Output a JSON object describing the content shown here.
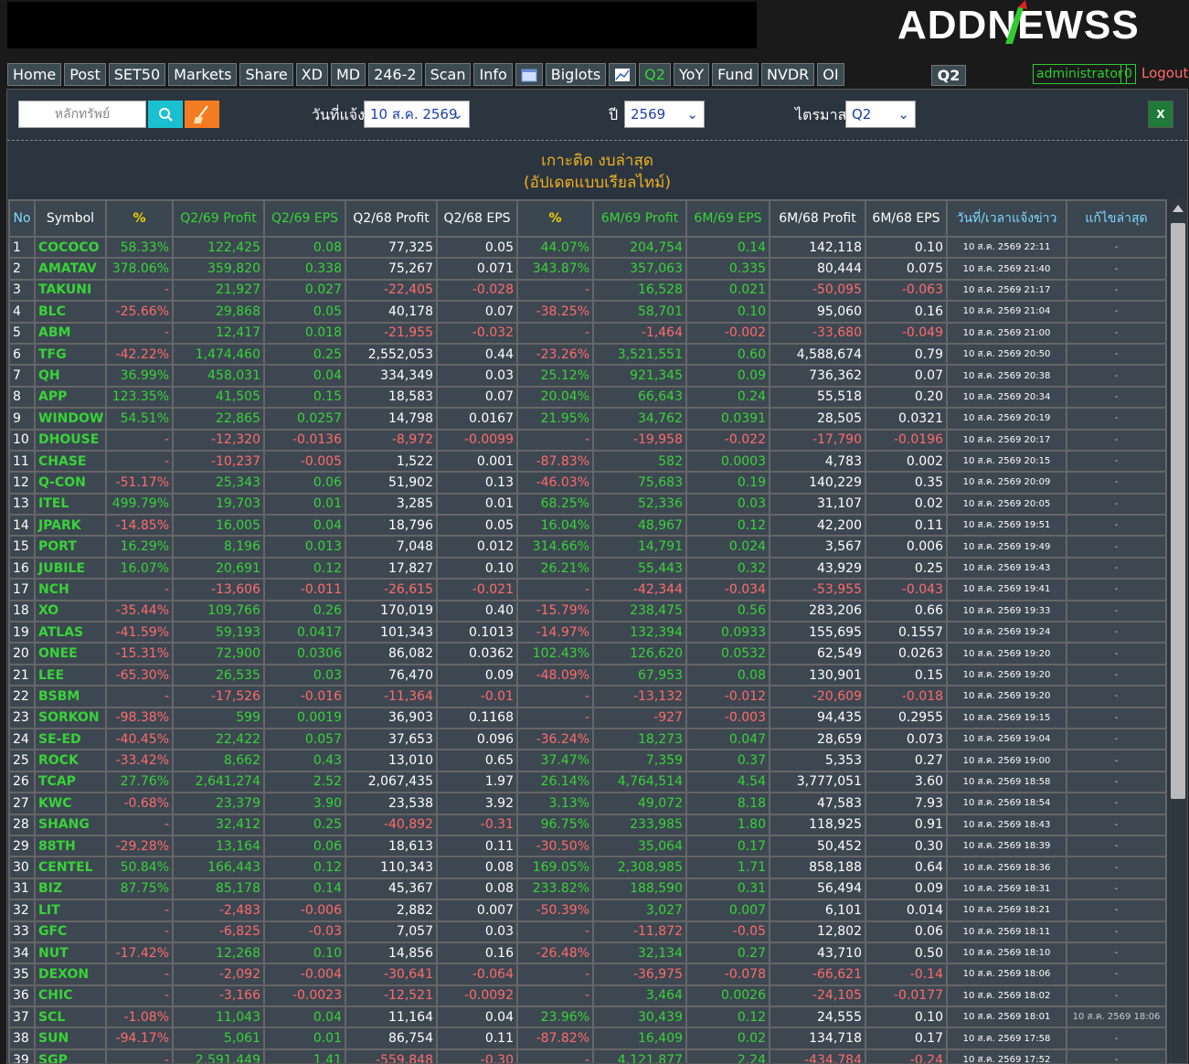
{
  "logo": "ADDNEWSS",
  "nav": [
    {
      "label": "Home",
      "type": "text"
    },
    {
      "label": "Post",
      "type": "text"
    },
    {
      "label": "SET50",
      "type": "text"
    },
    {
      "label": "Markets",
      "type": "text"
    },
    {
      "label": "Share",
      "type": "text"
    },
    {
      "label": "XD",
      "type": "text"
    },
    {
      "label": "MD",
      "type": "text"
    },
    {
      "label": "246-2",
      "type": "text"
    },
    {
      "label": "Scan",
      "type": "text"
    },
    {
      "label": "Info",
      "type": "text"
    },
    {
      "label": "",
      "type": "calendar-icon"
    },
    {
      "label": "Biglots",
      "type": "text"
    },
    {
      "label": "",
      "type": "chart-icon"
    },
    {
      "label": "Q2",
      "type": "green"
    },
    {
      "label": "YoY",
      "type": "text"
    },
    {
      "label": "Fund",
      "type": "text"
    },
    {
      "label": "NVDR",
      "type": "text"
    },
    {
      "label": "OI",
      "type": "text"
    }
  ],
  "quarter_badge": "Q2",
  "user": {
    "name": "administrator",
    "count": "0",
    "logout": "Logout"
  },
  "filters": {
    "search_placeholder": "หลักทรัพย์",
    "date_label": "วันที่แจ้ง",
    "date_value": "10 ส.ค. 2569",
    "year_label": "ปี",
    "year_value": "2569",
    "quarter_label": "ไตรมาส",
    "quarter_value": "Q2",
    "excel": "X"
  },
  "title_line1": "เกาะติด งบล่าสุด",
  "title_line2": "(อัปเดตแบบเรียลไทม์)",
  "headers": [
    "No",
    "Symbol",
    "%",
    "Q2/69 Profit",
    "Q2/69 EPS",
    "Q2/68 Profit",
    "Q2/68 EPS",
    "%",
    "6M/69 Profit",
    "6M/69 EPS",
    "6M/68 Profit",
    "6M/68 EPS",
    "วันที่/เวลาแจ้งข่าว",
    "แก้ไขล่าสุด"
  ],
  "rows": [
    [
      "1",
      "COCOCO",
      "58.33%",
      "122,425",
      "0.08",
      "77,325",
      "0.05",
      "44.07%",
      "204,754",
      "0.14",
      "142,118",
      "0.10",
      "10 ส.ค. 2569 22:11",
      "-"
    ],
    [
      "2",
      "AMATAV",
      "378.06%",
      "359,820",
      "0.338",
      "75,267",
      "0.071",
      "343.87%",
      "357,063",
      "0.335",
      "80,444",
      "0.075",
      "10 ส.ค. 2569 21:40",
      "-"
    ],
    [
      "3",
      "TAKUNI",
      "-",
      "21,927",
      "0.027",
      "-22,405",
      "-0.028",
      "-",
      "16,528",
      "0.021",
      "-50,095",
      "-0.063",
      "10 ส.ค. 2569 21:17",
      "-"
    ],
    [
      "4",
      "BLC",
      "-25.66%",
      "29,868",
      "0.05",
      "40,178",
      "0.07",
      "-38.25%",
      "58,701",
      "0.10",
      "95,060",
      "0.16",
      "10 ส.ค. 2569 21:04",
      "-"
    ],
    [
      "5",
      "ABM",
      "-",
      "12,417",
      "0.018",
      "-21,955",
      "-0.032",
      "-",
      "-1,464",
      "-0.002",
      "-33,680",
      "-0.049",
      "10 ส.ค. 2569 21:00",
      "-"
    ],
    [
      "6",
      "TFG",
      "-42.22%",
      "1,474,460",
      "0.25",
      "2,552,053",
      "0.44",
      "-23.26%",
      "3,521,551",
      "0.60",
      "4,588,674",
      "0.79",
      "10 ส.ค. 2569 20:50",
      "-"
    ],
    [
      "7",
      "QH",
      "36.99%",
      "458,031",
      "0.04",
      "334,349",
      "0.03",
      "25.12%",
      "921,345",
      "0.09",
      "736,362",
      "0.07",
      "10 ส.ค. 2569 20:38",
      "-"
    ],
    [
      "8",
      "APP",
      "123.35%",
      "41,505",
      "0.15",
      "18,583",
      "0.07",
      "20.04%",
      "66,643",
      "0.24",
      "55,518",
      "0.20",
      "10 ส.ค. 2569 20:34",
      "-"
    ],
    [
      "9",
      "WINDOW",
      "54.51%",
      "22,865",
      "0.0257",
      "14,798",
      "0.0167",
      "21.95%",
      "34,762",
      "0.0391",
      "28,505",
      "0.0321",
      "10 ส.ค. 2569 20:19",
      "-"
    ],
    [
      "10",
      "DHOUSE",
      "-",
      "-12,320",
      "-0.0136",
      "-8,972",
      "-0.0099",
      "-",
      "-19,958",
      "-0.022",
      "-17,790",
      "-0.0196",
      "10 ส.ค. 2569 20:17",
      "-"
    ],
    [
      "11",
      "CHASE",
      "-",
      "-10,237",
      "-0.005",
      "1,522",
      "0.001",
      "-87.83%",
      "582",
      "0.0003",
      "4,783",
      "0.002",
      "10 ส.ค. 2569 20:15",
      "-"
    ],
    [
      "12",
      "Q-CON",
      "-51.17%",
      "25,343",
      "0.06",
      "51,902",
      "0.13",
      "-46.03%",
      "75,683",
      "0.19",
      "140,229",
      "0.35",
      "10 ส.ค. 2569 20:09",
      "-"
    ],
    [
      "13",
      "ITEL",
      "499.79%",
      "19,703",
      "0.01",
      "3,285",
      "0.01",
      "68.25%",
      "52,336",
      "0.03",
      "31,107",
      "0.02",
      "10 ส.ค. 2569 20:05",
      "-"
    ],
    [
      "14",
      "JPARK",
      "-14.85%",
      "16,005",
      "0.04",
      "18,796",
      "0.05",
      "16.04%",
      "48,967",
      "0.12",
      "42,200",
      "0.11",
      "10 ส.ค. 2569 19:51",
      "-"
    ],
    [
      "15",
      "PORT",
      "16.29%",
      "8,196",
      "0.013",
      "7,048",
      "0.012",
      "314.66%",
      "14,791",
      "0.024",
      "3,567",
      "0.006",
      "10 ส.ค. 2569 19:49",
      "-"
    ],
    [
      "16",
      "JUBILE",
      "16.07%",
      "20,691",
      "0.12",
      "17,827",
      "0.10",
      "26.21%",
      "55,443",
      "0.32",
      "43,929",
      "0.25",
      "10 ส.ค. 2569 19:43",
      "-"
    ],
    [
      "17",
      "NCH",
      "-",
      "-13,606",
      "-0.011",
      "-26,615",
      "-0.021",
      "-",
      "-42,344",
      "-0.034",
      "-53,955",
      "-0.043",
      "10 ส.ค. 2569 19:41",
      "-"
    ],
    [
      "18",
      "XO",
      "-35.44%",
      "109,766",
      "0.26",
      "170,019",
      "0.40",
      "-15.79%",
      "238,475",
      "0.56",
      "283,206",
      "0.66",
      "10 ส.ค. 2569 19:33",
      "-"
    ],
    [
      "19",
      "ATLAS",
      "-41.59%",
      "59,193",
      "0.0417",
      "101,343",
      "0.1013",
      "-14.97%",
      "132,394",
      "0.0933",
      "155,695",
      "0.1557",
      "10 ส.ค. 2569 19:24",
      "-"
    ],
    [
      "20",
      "ONEE",
      "-15.31%",
      "72,900",
      "0.0306",
      "86,082",
      "0.0362",
      "102.43%",
      "126,620",
      "0.0532",
      "62,549",
      "0.0263",
      "10 ส.ค. 2569 19:20",
      "-"
    ],
    [
      "21",
      "LEE",
      "-65.30%",
      "26,535",
      "0.03",
      "76,470",
      "0.09",
      "-48.09%",
      "67,953",
      "0.08",
      "130,901",
      "0.15",
      "10 ส.ค. 2569 19:20",
      "-"
    ],
    [
      "22",
      "BSBM",
      "-",
      "-17,526",
      "-0.016",
      "-11,364",
      "-0.01",
      "-",
      "-13,132",
      "-0.012",
      "-20,609",
      "-0.018",
      "10 ส.ค. 2569 19:20",
      "-"
    ],
    [
      "23",
      "SORKON",
      "-98.38%",
      "599",
      "0.0019",
      "36,903",
      "0.1168",
      "-",
      "-927",
      "-0.003",
      "94,435",
      "0.2955",
      "10 ส.ค. 2569 19:15",
      "-"
    ],
    [
      "24",
      "SE-ED",
      "-40.45%",
      "22,422",
      "0.057",
      "37,653",
      "0.096",
      "-36.24%",
      "18,273",
      "0.047",
      "28,659",
      "0.073",
      "10 ส.ค. 2569 19:04",
      "-"
    ],
    [
      "25",
      "ROCK",
      "-33.42%",
      "8,662",
      "0.43",
      "13,010",
      "0.65",
      "37.47%",
      "7,359",
      "0.37",
      "5,353",
      "0.27",
      "10 ส.ค. 2569 19:00",
      "-"
    ],
    [
      "26",
      "TCAP",
      "27.76%",
      "2,641,274",
      "2.52",
      "2,067,435",
      "1.97",
      "26.14%",
      "4,764,514",
      "4.54",
      "3,777,051",
      "3.60",
      "10 ส.ค. 2569 18:58",
      "-"
    ],
    [
      "27",
      "KWC",
      "-0.68%",
      "23,379",
      "3.90",
      "23,538",
      "3.92",
      "3.13%",
      "49,072",
      "8.18",
      "47,583",
      "7.93",
      "10 ส.ค. 2569 18:54",
      "-"
    ],
    [
      "28",
      "SHANG",
      "-",
      "32,412",
      "0.25",
      "-40,892",
      "-0.31",
      "96.75%",
      "233,985",
      "1.80",
      "118,925",
      "0.91",
      "10 ส.ค. 2569 18:43",
      "-"
    ],
    [
      "29",
      "88TH",
      "-29.28%",
      "13,164",
      "0.06",
      "18,613",
      "0.11",
      "-30.50%",
      "35,064",
      "0.17",
      "50,452",
      "0.30",
      "10 ส.ค. 2569 18:39",
      "-"
    ],
    [
      "30",
      "CENTEL",
      "50.84%",
      "166,443",
      "0.12",
      "110,343",
      "0.08",
      "169.05%",
      "2,308,985",
      "1.71",
      "858,188",
      "0.64",
      "10 ส.ค. 2569 18:36",
      "-"
    ],
    [
      "31",
      "BIZ",
      "87.75%",
      "85,178",
      "0.14",
      "45,367",
      "0.08",
      "233.82%",
      "188,590",
      "0.31",
      "56,494",
      "0.09",
      "10 ส.ค. 2569 18:31",
      "-"
    ],
    [
      "32",
      "LIT",
      "-",
      "-2,483",
      "-0.006",
      "2,882",
      "0.007",
      "-50.39%",
      "3,027",
      "0.007",
      "6,101",
      "0.014",
      "10 ส.ค. 2569 18:21",
      "-"
    ],
    [
      "33",
      "GFC",
      "-",
      "-6,825",
      "-0.03",
      "7,057",
      "0.03",
      "-",
      "-11,872",
      "-0.05",
      "12,802",
      "0.06",
      "10 ส.ค. 2569 18:11",
      "-"
    ],
    [
      "34",
      "NUT",
      "-17.42%",
      "12,268",
      "0.10",
      "14,856",
      "0.16",
      "-26.48%",
      "32,134",
      "0.27",
      "43,710",
      "0.50",
      "10 ส.ค. 2569 18:10",
      "-"
    ],
    [
      "35",
      "DEXON",
      "-",
      "-2,092",
      "-0.004",
      "-30,641",
      "-0.064",
      "-",
      "-36,975",
      "-0.078",
      "-66,621",
      "-0.14",
      "10 ส.ค. 2569 18:06",
      "-"
    ],
    [
      "36",
      "CHIC",
      "-",
      "-3,166",
      "-0.0023",
      "-12,521",
      "-0.0092",
      "-",
      "3,464",
      "0.0026",
      "-24,105",
      "-0.0177",
      "10 ส.ค. 2569 18:02",
      "-"
    ],
    [
      "37",
      "SCL",
      "-1.08%",
      "11,043",
      "0.04",
      "11,164",
      "0.04",
      "23.96%",
      "30,439",
      "0.12",
      "24,555",
      "0.10",
      "10 ส.ค. 2569 18:01",
      "10 ส.ค. 2569 18:06"
    ],
    [
      "38",
      "SUN",
      "-94.17%",
      "5,061",
      "0.01",
      "86,754",
      "0.11",
      "-87.82%",
      "16,409",
      "0.02",
      "134,718",
      "0.17",
      "10 ส.ค. 2569 17:58",
      "-"
    ],
    [
      "39",
      "SGP",
      "-",
      "2,591,449",
      "1.41",
      "-559,848",
      "-0.30",
      "-",
      "4,121,877",
      "2.24",
      "-434,784",
      "-0.24",
      "10 ส.ค. 2569 17:52",
      "-"
    ]
  ]
}
